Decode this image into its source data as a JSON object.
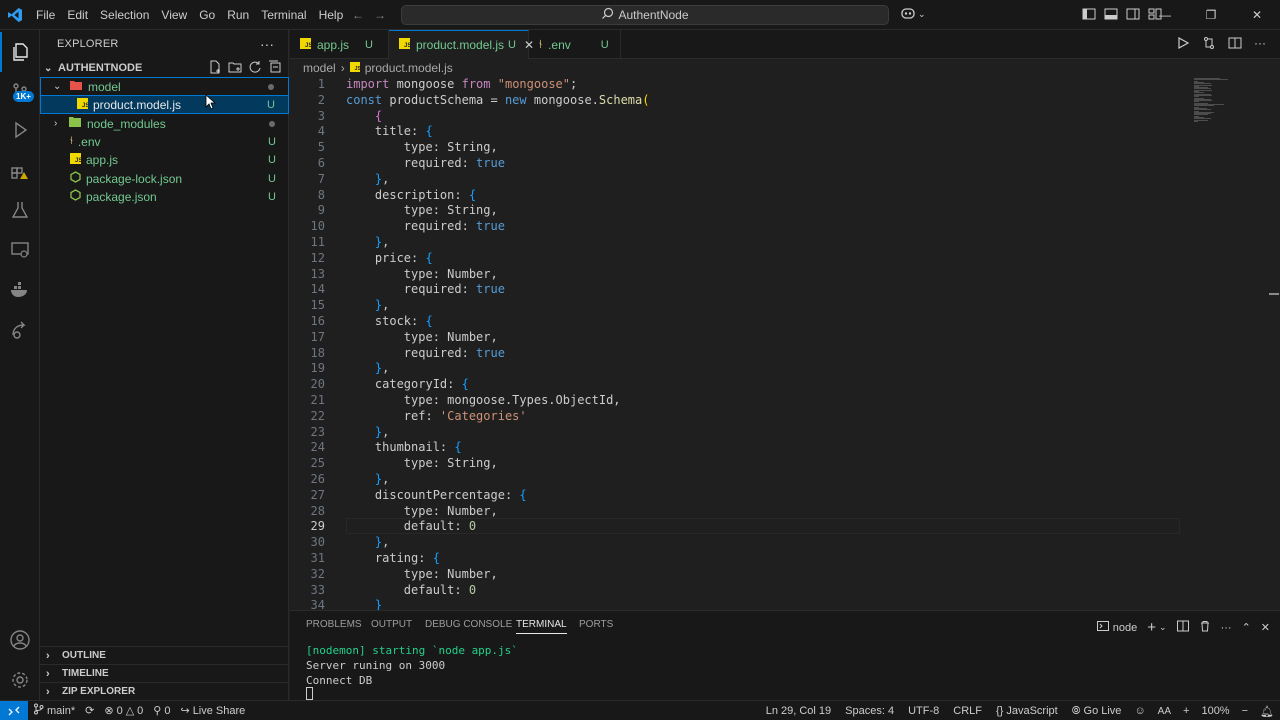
{
  "titlebar": {
    "menu": [
      "File",
      "Edit",
      "Selection",
      "View",
      "Go",
      "Run",
      "Terminal",
      "Help"
    ],
    "search_text": "AuthentNode"
  },
  "activity": {
    "badge": "1K+"
  },
  "explorer": {
    "title": "EXPLORER",
    "root": "AUTHENTNODE",
    "items": [
      {
        "label": "model",
        "status": "dot"
      },
      {
        "label": "product.model.js",
        "status": "U"
      },
      {
        "label": "node_modules",
        "status": "dot"
      },
      {
        "label": ".env",
        "status": "U"
      },
      {
        "label": "app.js",
        "status": "U"
      },
      {
        "label": "package-lock.json",
        "status": "U"
      },
      {
        "label": "package.json",
        "status": "U"
      }
    ],
    "sections": [
      "OUTLINE",
      "TIMELINE",
      "ZIP EXPLORER"
    ]
  },
  "tabs": [
    {
      "label": "app.js",
      "mod": "U"
    },
    {
      "label": "product.model.js",
      "mod": "U"
    },
    {
      "label": ".env",
      "mod": "U"
    }
  ],
  "breadcrumbs": {
    "folder": "model",
    "file": "product.model.js"
  },
  "editor": {
    "current_line": 29,
    "lines": [
      [
        [
          "kw",
          "import"
        ],
        [
          "id",
          " mongoose "
        ],
        [
          "kw",
          "from"
        ],
        [
          "id",
          " "
        ],
        [
          "str",
          "\"mongoose\""
        ],
        [
          "id",
          ";"
        ]
      ],
      [
        [
          "kw2",
          "const"
        ],
        [
          "id",
          " productSchema = "
        ],
        [
          "kw2",
          "new"
        ],
        [
          "id",
          " mongoose."
        ],
        [
          "fn",
          "Schema"
        ],
        [
          "b1",
          "("
        ]
      ],
      [
        [
          "id",
          "    "
        ],
        [
          "b2",
          "{"
        ]
      ],
      [
        [
          "id",
          "    title: "
        ],
        [
          "b3",
          "{"
        ]
      ],
      [
        [
          "id",
          "        type: String,"
        ]
      ],
      [
        [
          "id",
          "        required: "
        ],
        [
          "kw2",
          "true"
        ]
      ],
      [
        [
          "id",
          "    "
        ],
        [
          "b3",
          "}"
        ],
        [
          "id",
          ","
        ]
      ],
      [
        [
          "id",
          "    description: "
        ],
        [
          "b3",
          "{"
        ]
      ],
      [
        [
          "id",
          "        type: String,"
        ]
      ],
      [
        [
          "id",
          "        required: "
        ],
        [
          "kw2",
          "true"
        ]
      ],
      [
        [
          "id",
          "    "
        ],
        [
          "b3",
          "}"
        ],
        [
          "id",
          ","
        ]
      ],
      [
        [
          "id",
          "    price: "
        ],
        [
          "b3",
          "{"
        ]
      ],
      [
        [
          "id",
          "        type: Number,"
        ]
      ],
      [
        [
          "id",
          "        required: "
        ],
        [
          "kw2",
          "true"
        ]
      ],
      [
        [
          "id",
          "    "
        ],
        [
          "b3",
          "}"
        ],
        [
          "id",
          ","
        ]
      ],
      [
        [
          "id",
          "    stock: "
        ],
        [
          "b3",
          "{"
        ]
      ],
      [
        [
          "id",
          "        type: Number,"
        ]
      ],
      [
        [
          "id",
          "        required: "
        ],
        [
          "kw2",
          "true"
        ]
      ],
      [
        [
          "id",
          "    "
        ],
        [
          "b3",
          "}"
        ],
        [
          "id",
          ","
        ]
      ],
      [
        [
          "id",
          "    categoryId: "
        ],
        [
          "b3",
          "{"
        ]
      ],
      [
        [
          "id",
          "        type: mongoose.Types.ObjectId,"
        ]
      ],
      [
        [
          "id",
          "        ref: "
        ],
        [
          "str",
          "'Categories'"
        ]
      ],
      [
        [
          "id",
          "    "
        ],
        [
          "b3",
          "}"
        ],
        [
          "id",
          ","
        ]
      ],
      [
        [
          "id",
          "    thumbnail: "
        ],
        [
          "b3",
          "{"
        ]
      ],
      [
        [
          "id",
          "        type: String,"
        ]
      ],
      [
        [
          "id",
          "    "
        ],
        [
          "b3",
          "}"
        ],
        [
          "id",
          ","
        ]
      ],
      [
        [
          "id",
          "    discountPercentage: "
        ],
        [
          "b3",
          "{"
        ]
      ],
      [
        [
          "id",
          "        type: Number,"
        ]
      ],
      [
        [
          "id",
          "        default: "
        ],
        [
          "num",
          "0"
        ]
      ],
      [
        [
          "id",
          "    "
        ],
        [
          "b3",
          "}"
        ],
        [
          "id",
          ","
        ]
      ],
      [
        [
          "id",
          "    rating: "
        ],
        [
          "b3",
          "{"
        ]
      ],
      [
        [
          "id",
          "        type: Number,"
        ]
      ],
      [
        [
          "id",
          "        default: "
        ],
        [
          "num",
          "0"
        ]
      ],
      [
        [
          "id",
          "    "
        ],
        [
          "b3",
          "}"
        ]
      ]
    ]
  },
  "panel": {
    "tabs": [
      "PROBLEMS",
      "OUTPUT",
      "DEBUG CONSOLE",
      "TERMINAL",
      "PORTS"
    ],
    "active_tab": "TERMINAL",
    "terminal_name": "node",
    "terminal_lines": [
      "[nodemon] starting `node app.js`",
      "Server runing on 3000",
      "Connect DB"
    ]
  },
  "status": {
    "branch": "main*",
    "errors": "0",
    "warnings": "0",
    "ports": "0",
    "live_share": "Live Share",
    "position": "Ln 29, Col 19",
    "spaces": "Spaces: 4",
    "encoding": "UTF-8",
    "eol": "CRLF",
    "language": "JavaScript",
    "go_live": "Go Live",
    "zoom": "100%"
  }
}
